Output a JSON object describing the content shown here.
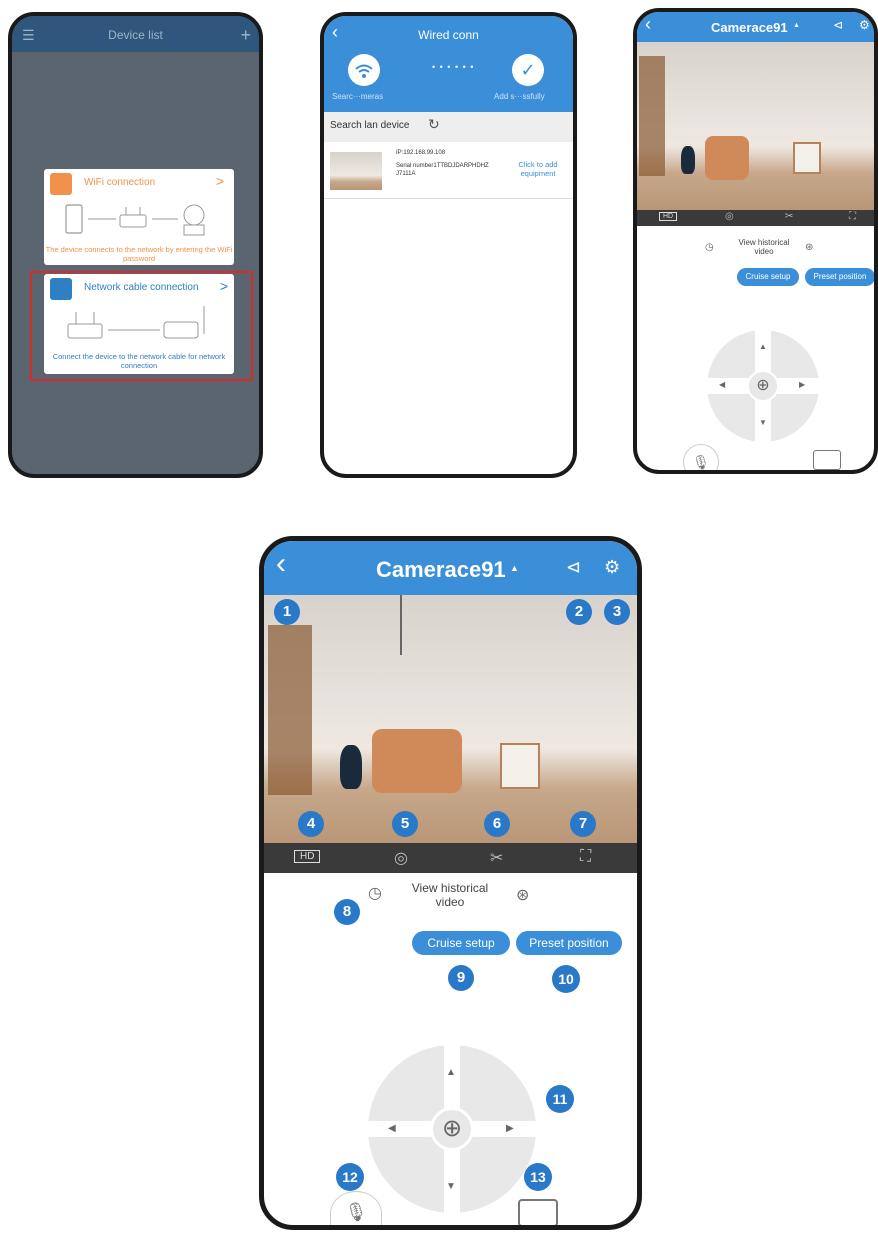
{
  "screen1": {
    "title": "Device list",
    "wifi_label": "WiFi connection",
    "wifi_desc": "The device connects to the network by entering the WiFi password",
    "cable_label": "Network cable connection",
    "cable_desc": "Connect the device to the network cable for network connection",
    "chevron": ">",
    "orange": "#f29149",
    "blue": "#2f7fc4",
    "highlight": "#d92b2b"
  },
  "screen2": {
    "title": "Wired conn",
    "step1": "Searc···meras",
    "step2": "Add s···ssfully",
    "dots": "• • • • • •",
    "search_label": "Search lan device",
    "ip": "IP:192.168.99.108",
    "serial": "Serial number1TTBDJDARPHDHZ J7111A",
    "add_link": "Click to add equipment"
  },
  "camera": {
    "title": "Camerace91",
    "caret": "▲",
    "hd": "HD",
    "history": "View historical video",
    "cruise": "Cruise setup",
    "preset": "Preset position",
    "accent": "#3b8fd8"
  },
  "callouts": [
    "1",
    "2",
    "3",
    "4",
    "5",
    "6",
    "7",
    "8",
    "9",
    "10",
    "11",
    "12",
    "13"
  ]
}
